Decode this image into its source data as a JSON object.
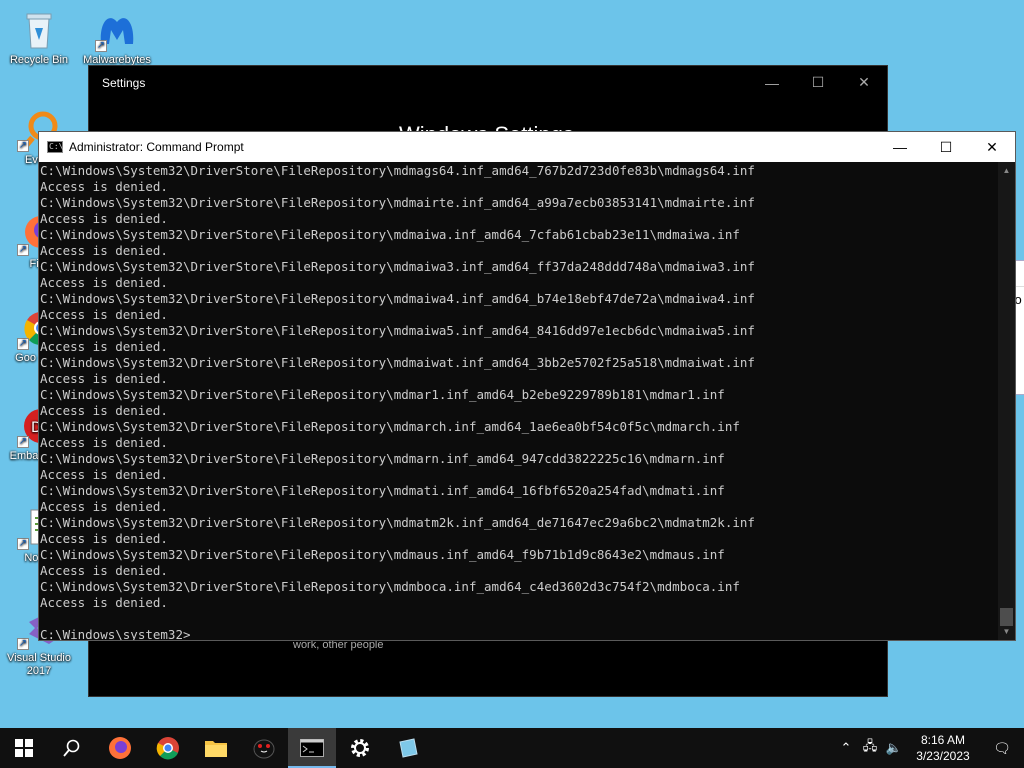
{
  "desktop": {
    "icons": [
      {
        "label": "Recycle Bin",
        "icon": "recycle-bin-icon"
      },
      {
        "label": "Malwarebytes",
        "icon": "malwarebytes-icon"
      },
      {
        "label": "Every",
        "icon": "everything-search-icon"
      },
      {
        "label": "Fire",
        "icon": "firefox-icon"
      },
      {
        "label": "Goo Chro",
        "icon": "chrome-icon"
      },
      {
        "label": "Embar Dev-",
        "icon": "embarcadero-dev-cpp-icon"
      },
      {
        "label": "Notep",
        "icon": "notepad-icon"
      },
      {
        "label": "Visual Studio 2017",
        "icon": "visual-studio-icon"
      }
    ]
  },
  "settings_window": {
    "title": "Settings",
    "heading": "Windows Settings",
    "footnote": "work, other people"
  },
  "cmd_window": {
    "title": "Administrator: Command Prompt",
    "lines": [
      "C:\\Windows\\System32\\DriverStore\\FileRepository\\mdmags64.inf_amd64_767b2d723d0fe83b\\mdmags64.inf",
      "Access is denied.",
      "C:\\Windows\\System32\\DriverStore\\FileRepository\\mdmairte.inf_amd64_a99a7ecb03853141\\mdmairte.inf",
      "Access is denied.",
      "C:\\Windows\\System32\\DriverStore\\FileRepository\\mdmaiwa.inf_amd64_7cfab61cbab23e11\\mdmaiwa.inf",
      "Access is denied.",
      "C:\\Windows\\System32\\DriverStore\\FileRepository\\mdmaiwa3.inf_amd64_ff37da248ddd748a\\mdmaiwa3.inf",
      "Access is denied.",
      "C:\\Windows\\System32\\DriverStore\\FileRepository\\mdmaiwa4.inf_amd64_b74e18ebf47de72a\\mdmaiwa4.inf",
      "Access is denied.",
      "C:\\Windows\\System32\\DriverStore\\FileRepository\\mdmaiwa5.inf_amd64_8416dd97e1ecb6dc\\mdmaiwa5.inf",
      "Access is denied.",
      "C:\\Windows\\System32\\DriverStore\\FileRepository\\mdmaiwat.inf_amd64_3bb2e5702f25a518\\mdmaiwat.inf",
      "Access is denied.",
      "C:\\Windows\\System32\\DriverStore\\FileRepository\\mdmar1.inf_amd64_b2ebe9229789b181\\mdmar1.inf",
      "Access is denied.",
      "C:\\Windows\\System32\\DriverStore\\FileRepository\\mdmarch.inf_amd64_1ae6ea0bf54c0f5c\\mdmarch.inf",
      "Access is denied.",
      "C:\\Windows\\System32\\DriverStore\\FileRepository\\mdmarn.inf_amd64_947cdd3822225c16\\mdmarn.inf",
      "Access is denied.",
      "C:\\Windows\\System32\\DriverStore\\FileRepository\\mdmati.inf_amd64_16fbf6520a254fad\\mdmati.inf",
      "Access is denied.",
      "C:\\Windows\\System32\\DriverStore\\FileRepository\\mdmatm2k.inf_amd64_de71647ec29a6bc2\\mdmatm2k.inf",
      "Access is denied.",
      "C:\\Windows\\System32\\DriverStore\\FileRepository\\mdmaus.inf_amd64_f9b71b1d9c8643e2\\mdmaus.inf",
      "Access is denied.",
      "C:\\Windows\\System32\\DriverStore\\FileRepository\\mdmboca.inf_amd64_c4ed3602d3c754f2\\mdmboca.inf",
      "Access is denied.",
      "",
      "C:\\Windows\\system32>"
    ]
  },
  "partial_window": {
    "text": "goo"
  },
  "taskbar": {
    "buttons": [
      {
        "icon": "start-icon"
      },
      {
        "icon": "search-icon"
      },
      {
        "icon": "firefox-icon"
      },
      {
        "icon": "chrome-icon"
      },
      {
        "icon": "file-explorer-icon"
      },
      {
        "icon": "penguin-app-icon"
      },
      {
        "icon": "command-prompt-icon",
        "active": true
      },
      {
        "icon": "settings-gear-icon"
      },
      {
        "icon": "notepad-icon"
      }
    ],
    "clock": {
      "time": "8:16 AM",
      "date": "3/23/2023"
    }
  },
  "colors": {
    "desktop": "#6cc4ea",
    "console_text": "#cccccc",
    "console_bg": "#0c0c0c",
    "taskbar": "#101010",
    "accent": "#76b9ed"
  }
}
